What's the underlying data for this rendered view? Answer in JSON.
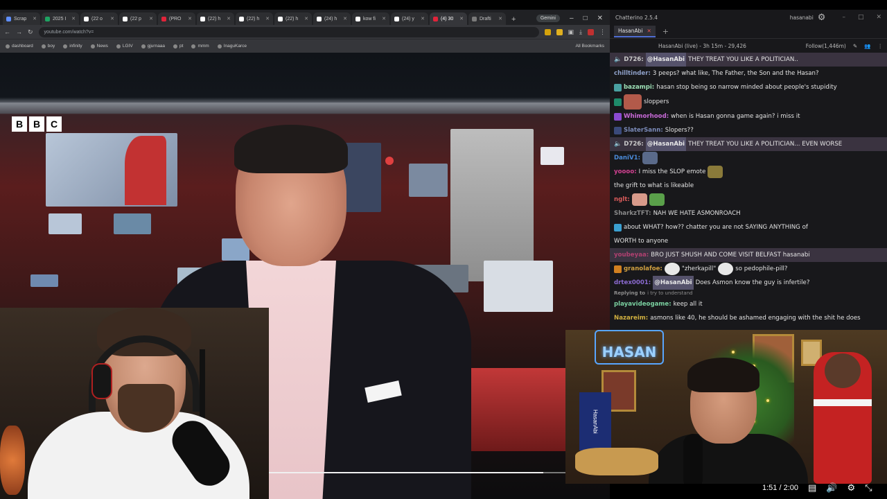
{
  "browser": {
    "tabs": [
      {
        "label": "Scrap",
        "color": "#5f8fff"
      },
      {
        "label": "2025 I",
        "color": "#1ea362"
      },
      {
        "label": "(22 o",
        "color": "#ffffff"
      },
      {
        "label": "(22 p",
        "color": "#ffffff"
      },
      {
        "label": "(PRO",
        "color": "#e0243a"
      },
      {
        "label": "(22) h",
        "color": "#ffffff"
      },
      {
        "label": "(22) h",
        "color": "#ffffff"
      },
      {
        "label": "(22) h",
        "color": "#ffffff"
      },
      {
        "label": "(24) h",
        "color": "#ffffff"
      },
      {
        "label": "kow fi",
        "color": "#ffffff"
      },
      {
        "label": "(24) y",
        "color": "#ffffff"
      },
      {
        "label": "(4) 30",
        "color": "#e0243a"
      },
      {
        "label": "Drafti",
        "color": "#7a7a7a"
      }
    ],
    "gemini_label": "Gemini",
    "url": "youtube.com/watch?v=",
    "bookmarks": [
      "dashboard",
      "boy",
      "infinity",
      "News",
      "LGIV",
      "gjurnaaa",
      "pt",
      "mmm",
      "InaguKarce"
    ],
    "all_bookmarks_label": "All Bookmarks"
  },
  "video": {
    "logo_letters": [
      "B",
      "B",
      "C"
    ],
    "current_time": "1:51",
    "duration": "2:00",
    "progress_fraction": 0.925
  },
  "chat": {
    "window_title": "Chatterino 2.5.4",
    "account": "hasanabi",
    "tab_label": "HasanAbi",
    "channel_status": "HasanAbi (live) - 3h 15m - 29,426",
    "follow_label": "Follow(1,446m)",
    "messages": [
      {
        "name": "D726:",
        "name_color": "#c8c8c8",
        "mention": "@HasanAbi",
        "text": "THEY TREAT YOU LIKE A POLITICIAN..",
        "highlight": true,
        "badge": "speaker"
      },
      {
        "name": "chilltinder:",
        "name_color": "#8fa0c8",
        "text": "3 peeps? what like, The Father, the Son and the Hasan?"
      },
      {
        "name": "bazampi:",
        "name_color": "#9ee0b6",
        "text": "hasan stop being so narrow minded about people's stupidity",
        "badge_color": "#4aa0a0"
      },
      {
        "name": "",
        "name_color": "#d04040",
        "text": "sloppers",
        "badge_color": "#1e8a6a",
        "emote_color": "#b25a4a"
      },
      {
        "name": "Whimorhood:",
        "name_color": "#c86ad8",
        "text": "when is Hasan gonna game again? i miss it",
        "badge_color": "#8a4ad0"
      },
      {
        "name": "SlaterSann:",
        "name_color": "#7a8ab8",
        "text": "Slopers??",
        "badge_color": "#3a4a7a"
      },
      {
        "name": "D726:",
        "name_color": "#c8c8c8",
        "mention": "@HasanAbi",
        "text": "THEY TREAT YOU LIKE A POLITICIAN... EVEN WORSE",
        "highlight": true,
        "badge": "speaker"
      },
      {
        "name": "DaniV1:",
        "name_color": "#4a8ad8",
        "text": "",
        "emote_color": "#5a6a8a"
      },
      {
        "name": "yoooo:",
        "name_color": "#d04090",
        "text": "I miss the SLOP emote",
        "emote_color": "#8a7a3a"
      },
      {
        "name": "",
        "name_color": "#d04040",
        "text": "the grift to what is likeable"
      },
      {
        "name": "nglt:",
        "name_color": "#d85a5a",
        "text": "",
        "emote_color": "#d89a8a",
        "emote2_color": "#5aa04a"
      },
      {
        "name": "SharkzTFT:",
        "name_color": "#8a8a8a",
        "text": "NAH WE HATE ASMONROACH"
      },
      {
        "name": "",
        "name_color": "#4a7ad8",
        "text": "about WHAT? how?? chatter you are not SAYING ANYTHING of",
        "badge_color": "#3aa0d0"
      },
      {
        "name": "",
        "name_color": "#e4e4e4",
        "text": "WORTH to anyone",
        "continuation": true
      },
      {
        "name": "youbeyaa:",
        "name_color": "#b04070",
        "text": "BRO JUST SHUSH AND COME VISIT BELFAST hasanabi",
        "highlight": true
      },
      {
        "name": "granolafoe:",
        "name_color": "#d0a040",
        "text": "\"zherkapill\"",
        "text2": "so pedophile-pill?",
        "badge_color": "#d08020",
        "emote_color": "#e8e8e8",
        "emote2_color": "#e8e8e8"
      },
      {
        "name": "drtex0001:",
        "name_color": "#8a6ad0",
        "mention": "@HasanAbi",
        "text": "Does Asmon know the guy is infertile?"
      },
      {
        "name": "Replying to",
        "name_color": "#8d8d8d",
        "text": "i try to understand",
        "small": true
      },
      {
        "name": "playavideogame:",
        "name_color": "#7ad0a0",
        "text": "keep all it"
      },
      {
        "name": "Nazareim:",
        "name_color": "#d0b040",
        "text": "asmons like 40, he should be ashamed engaging with the shit he does"
      }
    ]
  },
  "streamer_cam": {
    "neon_sign": "HASAN",
    "banner": "HasanAbi"
  }
}
